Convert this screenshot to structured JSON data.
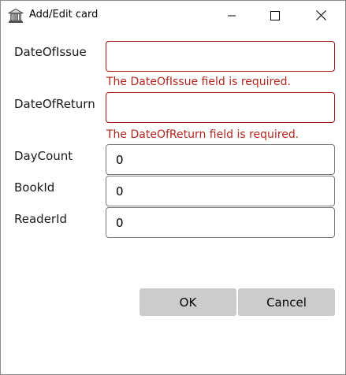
{
  "window": {
    "title": "Add/Edit card",
    "app_icon": "bank-building-icon",
    "controls": [
      "minimize-icon",
      "maximize-icon",
      "close-icon"
    ]
  },
  "form": {
    "date_of_issue": {
      "label": "DateOfIssue",
      "value": "",
      "error": "The DateOfIssue field is required."
    },
    "date_of_return": {
      "label": "DateOfReturn",
      "value": "",
      "error": "The DateOfReturn field is required."
    },
    "day_count": {
      "label": "DayCount",
      "value": "0"
    },
    "book_id": {
      "label": "BookId",
      "value": "0"
    },
    "reader_id": {
      "label": "ReaderId",
      "value": "0"
    }
  },
  "buttons": {
    "ok_label": "OK",
    "cancel_label": "Cancel"
  },
  "colors": {
    "error": "#b3261e",
    "invalid_border": "#a31515",
    "button_bg": "#cccccc"
  }
}
